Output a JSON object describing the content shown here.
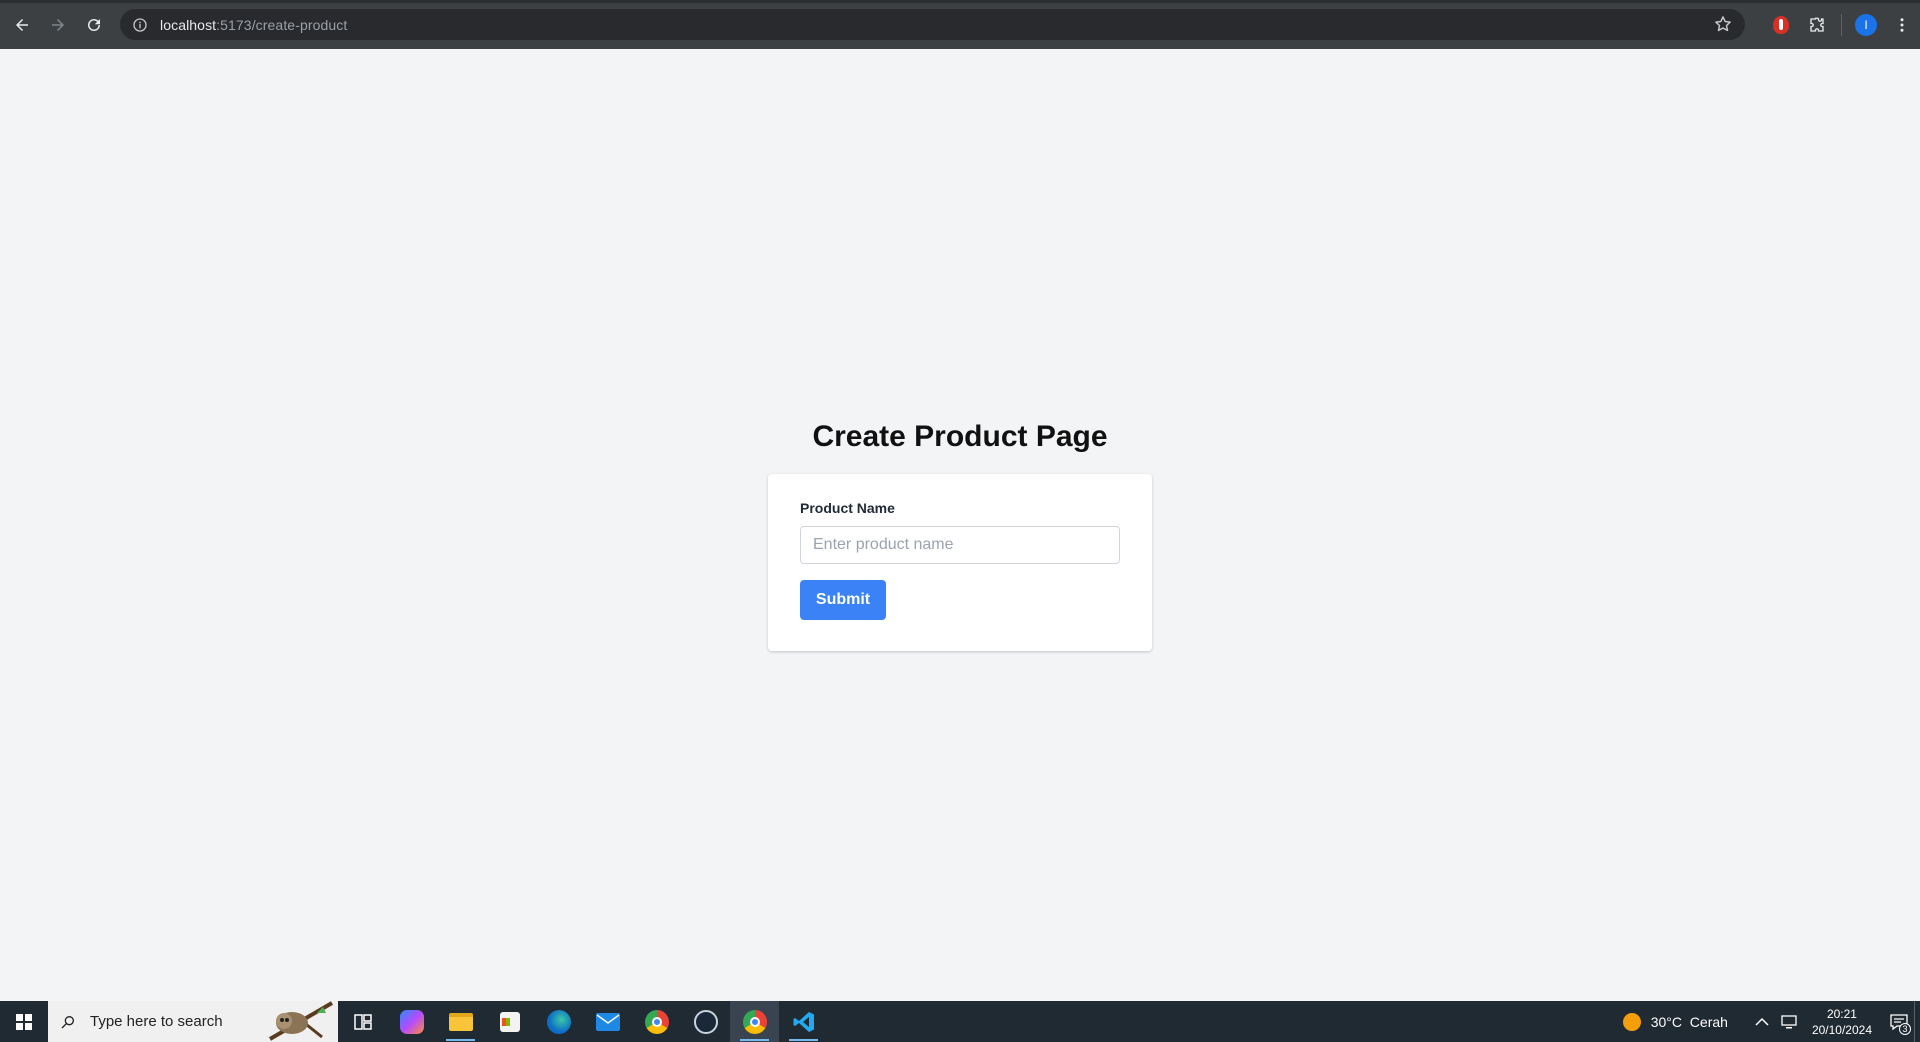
{
  "browser": {
    "url_host": "localhost",
    "url_path": ":5173/create-product",
    "profile_initial": "I",
    "icons": [
      "back-icon",
      "forward-icon",
      "reload-icon",
      "site-info-icon",
      "bookmark-star-icon",
      "extension-icon",
      "puzzle-icon",
      "menu-dots-icon"
    ]
  },
  "page": {
    "title": "Create Product Page",
    "form": {
      "field_label": "Product Name",
      "field_value": "",
      "field_placeholder": "Enter product name",
      "submit_label": "Submit"
    }
  },
  "taskbar": {
    "search_placeholder": "Type here to search",
    "apps": [
      "task-view",
      "copilot",
      "file-explorer",
      "microsoft-store",
      "edge",
      "mail",
      "chrome",
      "steam",
      "chrome-active",
      "vscode"
    ],
    "weather_temp": "30°C",
    "weather_desc": "Cerah",
    "time": "20:21",
    "date": "20/10/2024",
    "notification_count": "3"
  },
  "colors": {
    "page_bg": "#f3f4f6",
    "submit_bg": "#3b82f6",
    "browser_bar": "#3c4043",
    "taskbar_bg": "#202a33"
  }
}
